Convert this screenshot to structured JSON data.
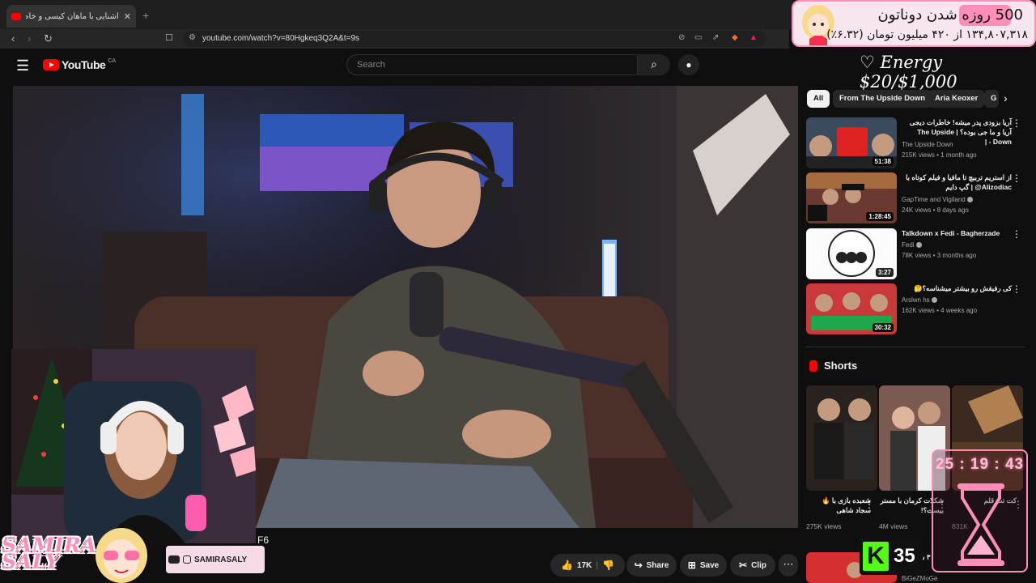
{
  "browser": {
    "tab_title": "آشنایی با ماهان کیسی و خاطرات ...",
    "url": "youtube.com/watch?v=80Hgkeq3Q2A&t=9s"
  },
  "youtube": {
    "logo_text": "YouTube",
    "country_code": "CA",
    "search_placeholder": "Search"
  },
  "overlays": {
    "energy_text": "♡ Energy $20/$1,000",
    "donation_line1": "500 روزه شدن دوناتون",
    "donation_line2": "۱۳۴,۸۰۷,۳۱۸ از ۴۲۰ میلیون تومان (۶.۳۲٪)",
    "brand_line1": "SAMIRA",
    "brand_line2": "SALY",
    "social_handle": "SAMIRASALY",
    "timer": "25 : 19 : 43",
    "kick_count": "35",
    "caption_fragment": "F6"
  },
  "actions": {
    "likes": "17K",
    "share": "Share",
    "save": "Save",
    "clip": "Clip"
  },
  "chips": [
    "All",
    "From The Upside Down",
    "Aria Keoxer",
    "G"
  ],
  "recommended": [
    {
      "title": "آریا بزودی پدر میشه! خاطرات دیجی آریا و ما جی بوده؟ | The Upside Down - |",
      "channel": "The Upside Down",
      "meta": "215K views • 1 month ago",
      "duration": "51:38",
      "verified": false
    },
    {
      "title": "از استریم تربیچ تا مافیا و فیلم کوتاه با Alizodiac@ | گپ دایم",
      "channel": "GapTime and Vigiland",
      "meta": "24K views • 8 days ago",
      "duration": "1:28:45",
      "verified": true
    },
    {
      "title": "Talkdown x Fedi - Bagherzade",
      "channel": "Fedi",
      "meta": "78K views • 3 months ago",
      "duration": "3:27",
      "verified": true
    },
    {
      "title": "کی رفیقش رو بیشتر میشناسه؟🤔",
      "channel": "Arslwn hs",
      "meta": "162K views • 4 weeks ago",
      "duration": "30:32",
      "verified": true
    }
  ],
  "shorts": {
    "heading": "Shorts",
    "items": [
      {
        "title": "شعبده بازی با 🔥 سجاد شاهی",
        "views": "275K views"
      },
      {
        "title": "شکلات کرمان با مستر بیست؟!",
        "views": "4M views"
      },
      {
        "title": "کت تت قلم",
        "views": "831K"
      }
    ]
  },
  "bottom_rec": {
    "title": "۳۰ سال چ...",
    "channel": "BiGeZMoGe"
  },
  "colors": {
    "accent": "#ff0000",
    "overlay_pink": "#ff8fb8",
    "kick_green": "#53fc18"
  }
}
